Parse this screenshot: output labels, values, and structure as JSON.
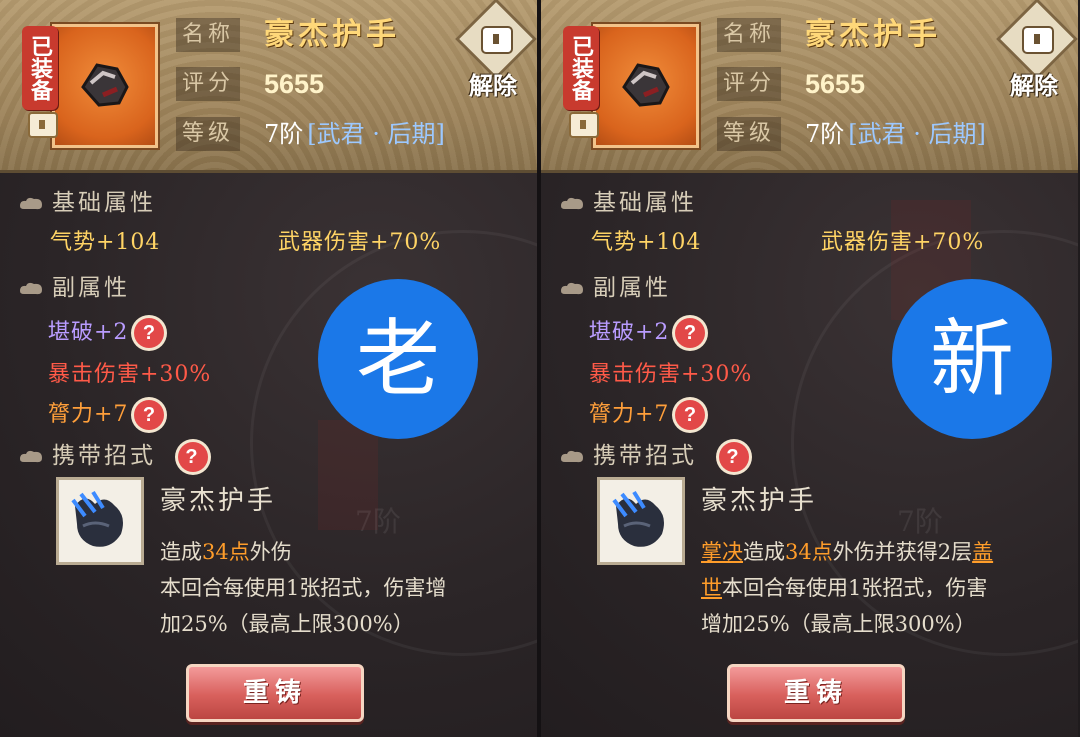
{
  "badges": {
    "old": "老",
    "new": "新"
  },
  "panels": [
    {
      "equipped_tag": "已装备",
      "labels": {
        "name": "名称",
        "score": "评分",
        "level": "等级"
      },
      "item_name": "豪杰护手",
      "score": "5655",
      "level": "7阶",
      "realm": "[武君 · 后期]",
      "unequip": "解除",
      "basic_title": "基础属性",
      "basic_stats": [
        "气势+104",
        "武器伤害+70%"
      ],
      "sub_title": "副属性",
      "sub_stats": [
        "堪破+2",
        "暴击伤害+30%",
        "膂力+7"
      ],
      "skill_title": "携带招式",
      "skill_name": "豪杰护手",
      "desc_line1_pre": "造成",
      "desc_line1_num": "34点",
      "desc_line1_post": "外伤",
      "desc_line2": "本回合每使用1张招式，伤害增",
      "desc_line3": "加25%（最高上限300%）",
      "reforge": "重铸",
      "bg_level": "7阶"
    },
    {
      "equipped_tag": "已装备",
      "labels": {
        "name": "名称",
        "score": "评分",
        "level": "等级"
      },
      "item_name": "豪杰护手",
      "score": "5655",
      "level": "7阶",
      "realm": "[武君 · 后期]",
      "unequip": "解除",
      "basic_title": "基础属性",
      "basic_stats": [
        "气势+104",
        "武器伤害+70%"
      ],
      "sub_title": "副属性",
      "sub_stats": [
        "堪破+2",
        "暴击伤害+30%",
        "膂力+7"
      ],
      "skill_title": "携带招式",
      "skill_name": "豪杰护手",
      "desc_key1": "掌决",
      "desc_line1_a": "造成",
      "desc_line1_num": "34点",
      "desc_line1_b": "外伤并获得2层",
      "desc_key2_part1": "盖",
      "desc_key2_part2": "世",
      "desc_line2": "本回合每使用1张招式，伤害",
      "desc_line3": "增加25%（最高上限300%）",
      "reforge": "重铸",
      "bg_level": "7阶"
    }
  ],
  "colors": {
    "header_bg": "#a88e63",
    "item_card_orange": "#e06a22",
    "badge_blue": "#1b78e8",
    "reforge_button": "#d8605c",
    "stat_gold": "#ffd465",
    "stat_purple": "#b99cff",
    "stat_red": "#ff5a48",
    "highlight_orange": "#ff9d2a"
  }
}
